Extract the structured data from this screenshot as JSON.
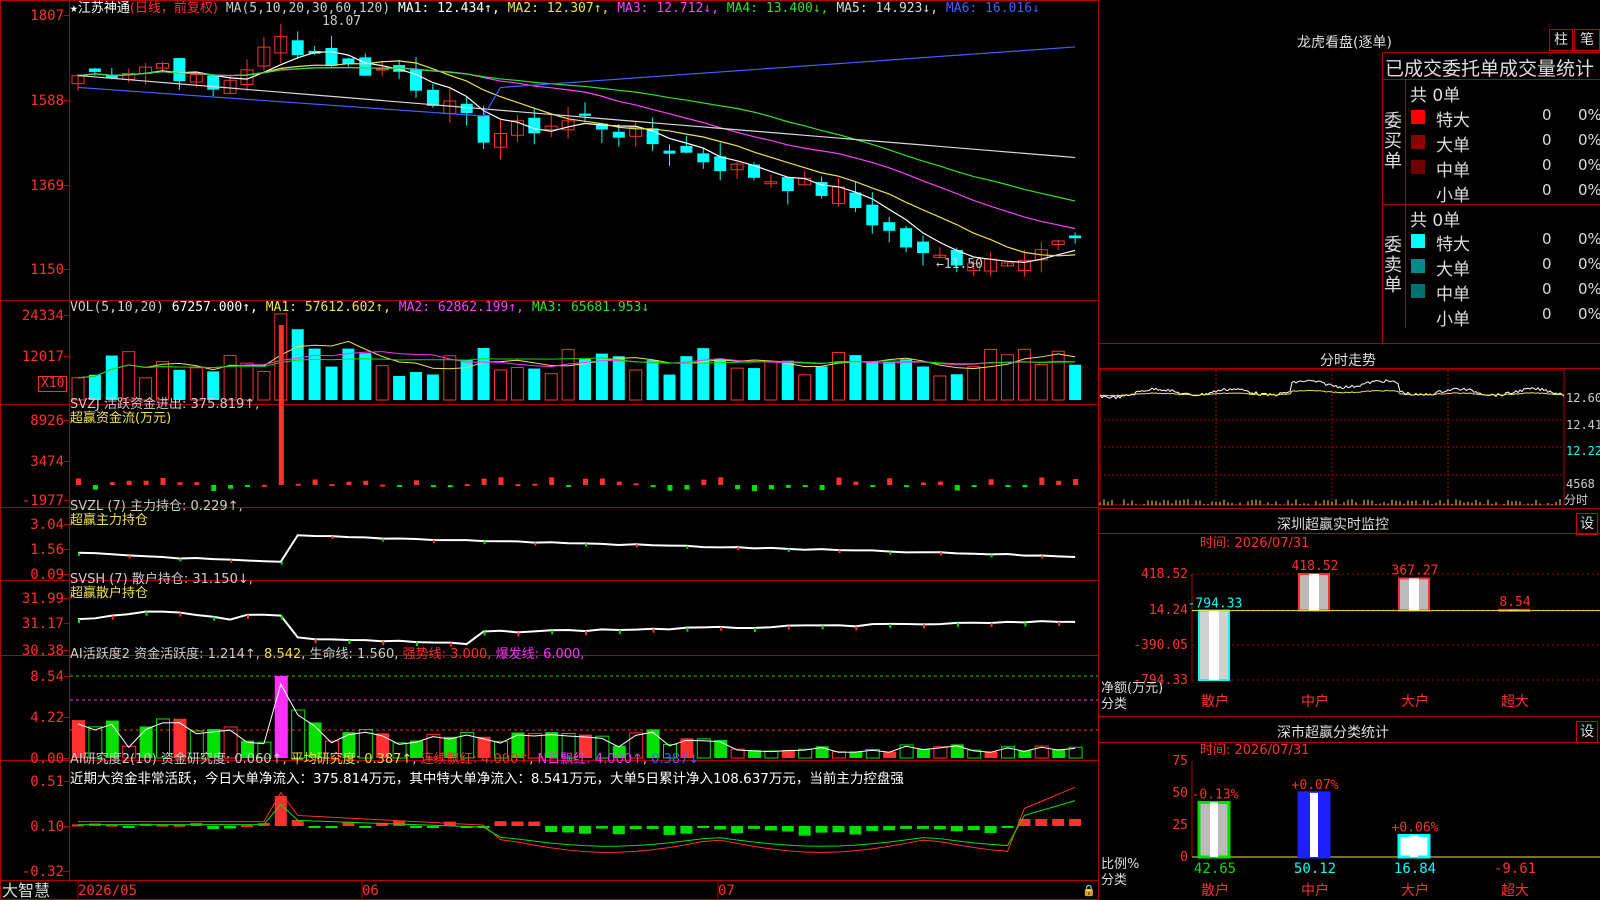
{
  "stock": {
    "star": "★",
    "name": "江苏神通",
    "period": "(日线，前复权)",
    "ma_header": "MA(5,10,20,30,60,120)",
    "ma": [
      {
        "label": "MA1:",
        "value": "12.434",
        "dir": "↑",
        "color": "#ffffff"
      },
      {
        "label": "MA2:",
        "value": "12.307",
        "dir": "↑",
        "color": "#f0e050"
      },
      {
        "label": "MA3:",
        "value": "12.712",
        "dir": "↓",
        "color": "#ff40ff"
      },
      {
        "label": "MA4:",
        "value": "13.400",
        "dir": "↓",
        "color": "#30e030"
      },
      {
        "label": "MA5:",
        "value": "14.923",
        "dir": "↓",
        "color": "#d8d8d8"
      },
      {
        "label": "MA6:",
        "value": "16.016",
        "dir": "↓",
        "color": "#4060ff"
      }
    ],
    "high_mark": "18.07",
    "low_mark": "←11.50",
    "y_ticks": [
      "1807",
      "1588",
      "1369",
      "1150"
    ]
  },
  "vol": {
    "header": "VOL(5,10,20)",
    "value": "67257.000↑",
    "ma": [
      {
        "label": "MA1:",
        "value": "57612.602↑",
        "color": "#f0e050"
      },
      {
        "label": "MA2:",
        "value": "62862.199↑",
        "color": "#ff40ff"
      },
      {
        "label": "MA3:",
        "value": "65681.953↓",
        "color": "#30e030"
      }
    ],
    "y_ticks": [
      "24334",
      "12017"
    ],
    "unit": "X10"
  },
  "svzj": {
    "header": "SVZJ  活跃资金进出: 375.819↑,",
    "sub": "超赢资金流(万元)",
    "y_ticks": [
      "8926",
      "3474",
      "-1977"
    ]
  },
  "svzl": {
    "header": "SVZL (7) 主力持仓: 0.229↑,",
    "sub": "超赢主力持仓",
    "y_ticks": [
      "3.04",
      "1.56",
      "0.09"
    ]
  },
  "svsh": {
    "header": "SVSH (7) 散户持仓: 31.150↓,",
    "sub": "超赢散户持仓",
    "y_ticks": [
      "31.99",
      "31.17",
      "30.38"
    ]
  },
  "ai_act": {
    "header_a": "AI活跃度2 资金活跃度: 1.214↑",
    "header_b": "8.542,",
    "header_c": "生命线: 1.560,",
    "header_d": "强势线: 3.000,",
    "header_e": "爆发线: 6.000,",
    "y_ticks": [
      "8.54",
      "4.22",
      "0.00"
    ]
  },
  "ai_res": {
    "header_a": "AI研究度2(10) 资金研究度: 0.060↑",
    "header_b": "平均研究度: 0.387↑",
    "header_c": "连续飘红: 4.000↑",
    "header_d": "N日飘红: 4.000↑",
    "header_e": "0.387↓",
    "note": "近期大资金非常活跃，今日大单净流入：375.814万元，其中特大单净流入：8.541万元，大单5日累计净入108.637万元，当前主力控盘强",
    "y_ticks": [
      "0.51",
      "0.10",
      "-0.32"
    ]
  },
  "xaxis": {
    "logo": "大智慧",
    "labels": [
      "2026/05",
      "06",
      "07"
    ]
  },
  "dragon": {
    "title": "龙虎看盘(逐单)",
    "btn1": "柱",
    "btn2": "笔",
    "tabs": "已成交委托单成交量统计",
    "buy_total": "共 0单",
    "sell_total": "共 0单",
    "buy_label": "委买单",
    "sell_label": "委卖单",
    "buy_rows": [
      {
        "name": "特大",
        "count": "0",
        "pct": "0%",
        "color": "#ff0000"
      },
      {
        "name": "大单",
        "count": "0",
        "pct": "0%",
        "color": "#8b0000"
      },
      {
        "name": "中单",
        "count": "0",
        "pct": "0%",
        "color": "#700000"
      },
      {
        "name": "小单",
        "count": "0",
        "pct": "0%",
        "color": ""
      }
    ],
    "sell_rows": [
      {
        "name": "特大",
        "count": "0",
        "pct": "0%",
        "color": "#00ffff"
      },
      {
        "name": "大单",
        "count": "0",
        "pct": "0%",
        "color": "#008b8b"
      },
      {
        "name": "中单",
        "count": "0",
        "pct": "0%",
        "color": "#007070"
      },
      {
        "name": "小单",
        "count": "0",
        "pct": "0%",
        "color": ""
      }
    ]
  },
  "intraday": {
    "title": "分时走势",
    "y_ticks": [
      "12.60",
      "12.41",
      "12.22"
    ],
    "vol_tick": "4568",
    "vol_unit": "分时"
  },
  "monitor": {
    "title": "深圳超赢实时监控",
    "set_label": "设",
    "time": "时间: 2026/07/31",
    "y_ticks": [
      "418.52",
      "14.24",
      "-390.05",
      "-794.33"
    ],
    "ylabel": "净额(万元)",
    "xlabel": "分类",
    "cats": [
      "散户",
      "中户",
      "大户",
      "超大"
    ],
    "values": [
      -794.33,
      418.52,
      367.27,
      8.54
    ],
    "value_labels": [
      "-794.33",
      "418.52",
      "367.27",
      "8.54"
    ]
  },
  "classify": {
    "title": "深市超赢分类统计",
    "set_label": "设",
    "time": "时间: 2026/07/31",
    "y_ticks": [
      "75",
      "50",
      "25",
      "0"
    ],
    "ylabel": "比例%",
    "xlabel": "分类",
    "cats": [
      "散户",
      "中户",
      "大户",
      "超大"
    ],
    "values": [
      42.65,
      50.12,
      16.84,
      -9.61
    ],
    "value_labels": [
      "42.65",
      "50.12",
      "16.84",
      "-9.61"
    ],
    "change_labels": [
      "-0.13%",
      "+0.07%",
      "+0.06%",
      ""
    ]
  },
  "colors": {
    "up": "#ff3030",
    "down": "#00ffff",
    "border": "#b00000",
    "green": "#00e000",
    "magenta": "#ff30ff",
    "yellow": "#f0e050"
  }
}
